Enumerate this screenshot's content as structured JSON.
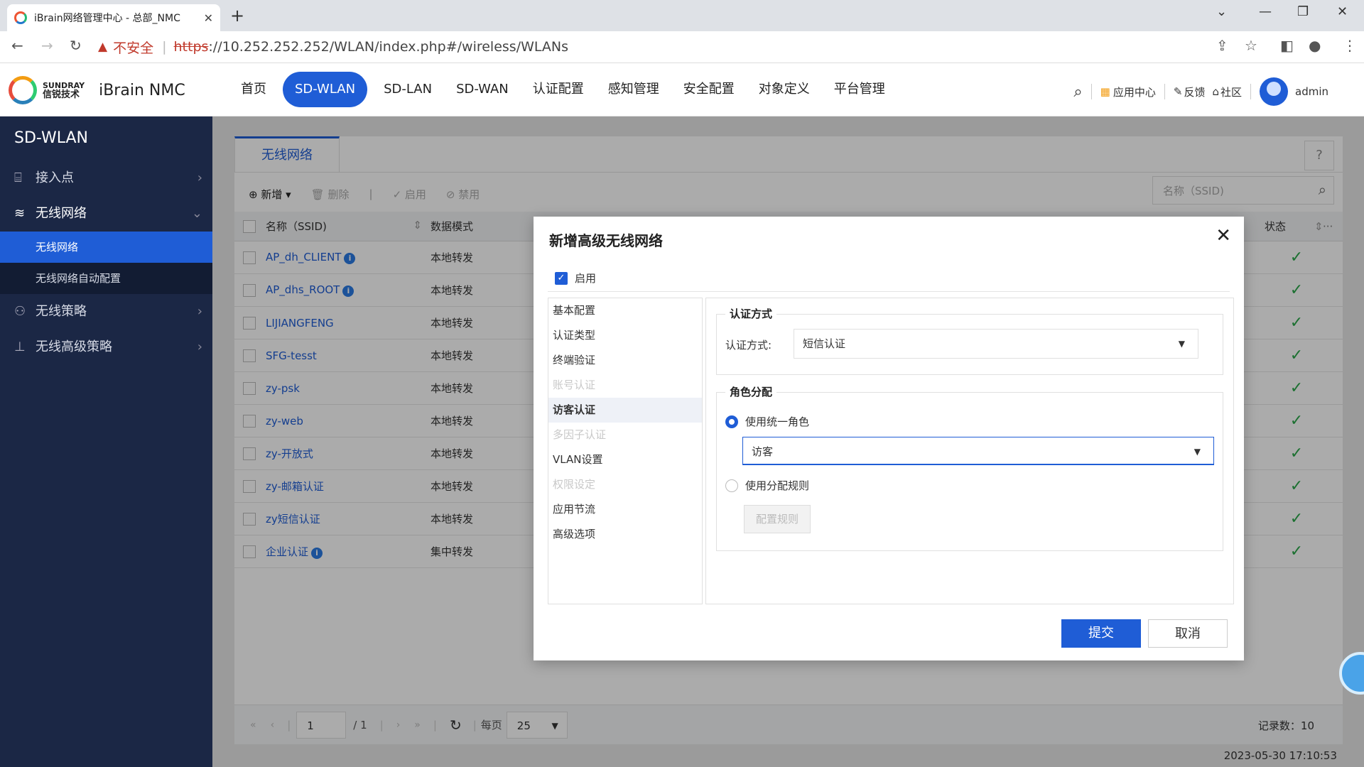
{
  "browser": {
    "tab_title": "iBrain网络管理中心 - 总部_NMC",
    "url_warning": "不安全",
    "url_scheme": "https",
    "url_rest": "://10.252.252.252/WLAN/index.php#/wireless/WLANs"
  },
  "appbar": {
    "brand_en": "SUNDRAY",
    "brand_cn": "信锐技术",
    "product": "iBrain NMC",
    "menu": [
      "首页",
      "SD-WLAN",
      "SD-LAN",
      "SD-WAN",
      "认证配置",
      "感知管理",
      "安全配置",
      "对象定义",
      "平台管理"
    ],
    "app_center": "应用中心",
    "feedback": "反馈",
    "community": "社区",
    "user": "admin"
  },
  "sidebar": {
    "title": "SD-WLAN",
    "items": [
      {
        "label": "接入点"
      },
      {
        "label": "无线网络"
      },
      {
        "label": "无线网络"
      },
      {
        "label": "无线网络自动配置"
      },
      {
        "label": "无线策略"
      },
      {
        "label": "无线高级策略"
      }
    ]
  },
  "main": {
    "tab": "无线网络",
    "toolbar": {
      "add": "新增",
      "delete": "删除",
      "enable": "启用",
      "disable": "禁用"
    },
    "search_placeholder": "名称（SSID)",
    "columns": {
      "name": "名称（SSID)",
      "mode": "数据模式",
      "state": "状态"
    },
    "rows": [
      {
        "name": "AP_dh_CLIENT",
        "mode": "本地转发"
      },
      {
        "name": "AP_dhs_ROOT",
        "mode": "本地转发"
      },
      {
        "name": "LIJIANGFENG",
        "mode": "本地转发"
      },
      {
        "name": "SFG-tesst",
        "mode": "本地转发"
      },
      {
        "name": "zy-psk",
        "mode": "本地转发"
      },
      {
        "name": "zy-web",
        "mode": "本地转发"
      },
      {
        "name": "zy-开放式",
        "mode": "本地转发"
      },
      {
        "name": "zy-邮箱认证",
        "mode": "本地转发"
      },
      {
        "name": "zy短信认证",
        "mode": "本地转发"
      },
      {
        "name": "企业认证",
        "mode": "集中转发"
      }
    ],
    "pager": {
      "page": "1",
      "total": "/ 1",
      "per_page_label": "每页",
      "per_page": "25",
      "records": "记录数：10"
    },
    "timestamp": "2023-05-30 17:10:53"
  },
  "dialog": {
    "title": "新增高级无线网络",
    "enable_label": "启用",
    "nav": [
      "基本配置",
      "认证类型",
      "终端验证",
      "账号认证",
      "访客认证",
      "多因子认证",
      "VLAN设置",
      "权限设定",
      "应用节流",
      "高级选项"
    ],
    "auth_section": "认证方式",
    "auth_label": "认证方式:",
    "auth_value": "短信认证",
    "role_section": "角色分配",
    "role_unified": "使用统一角色",
    "role_value": "访客",
    "role_rules": "使用分配规则",
    "config_rules": "配置规则",
    "submit": "提交",
    "cancel": "取消"
  }
}
